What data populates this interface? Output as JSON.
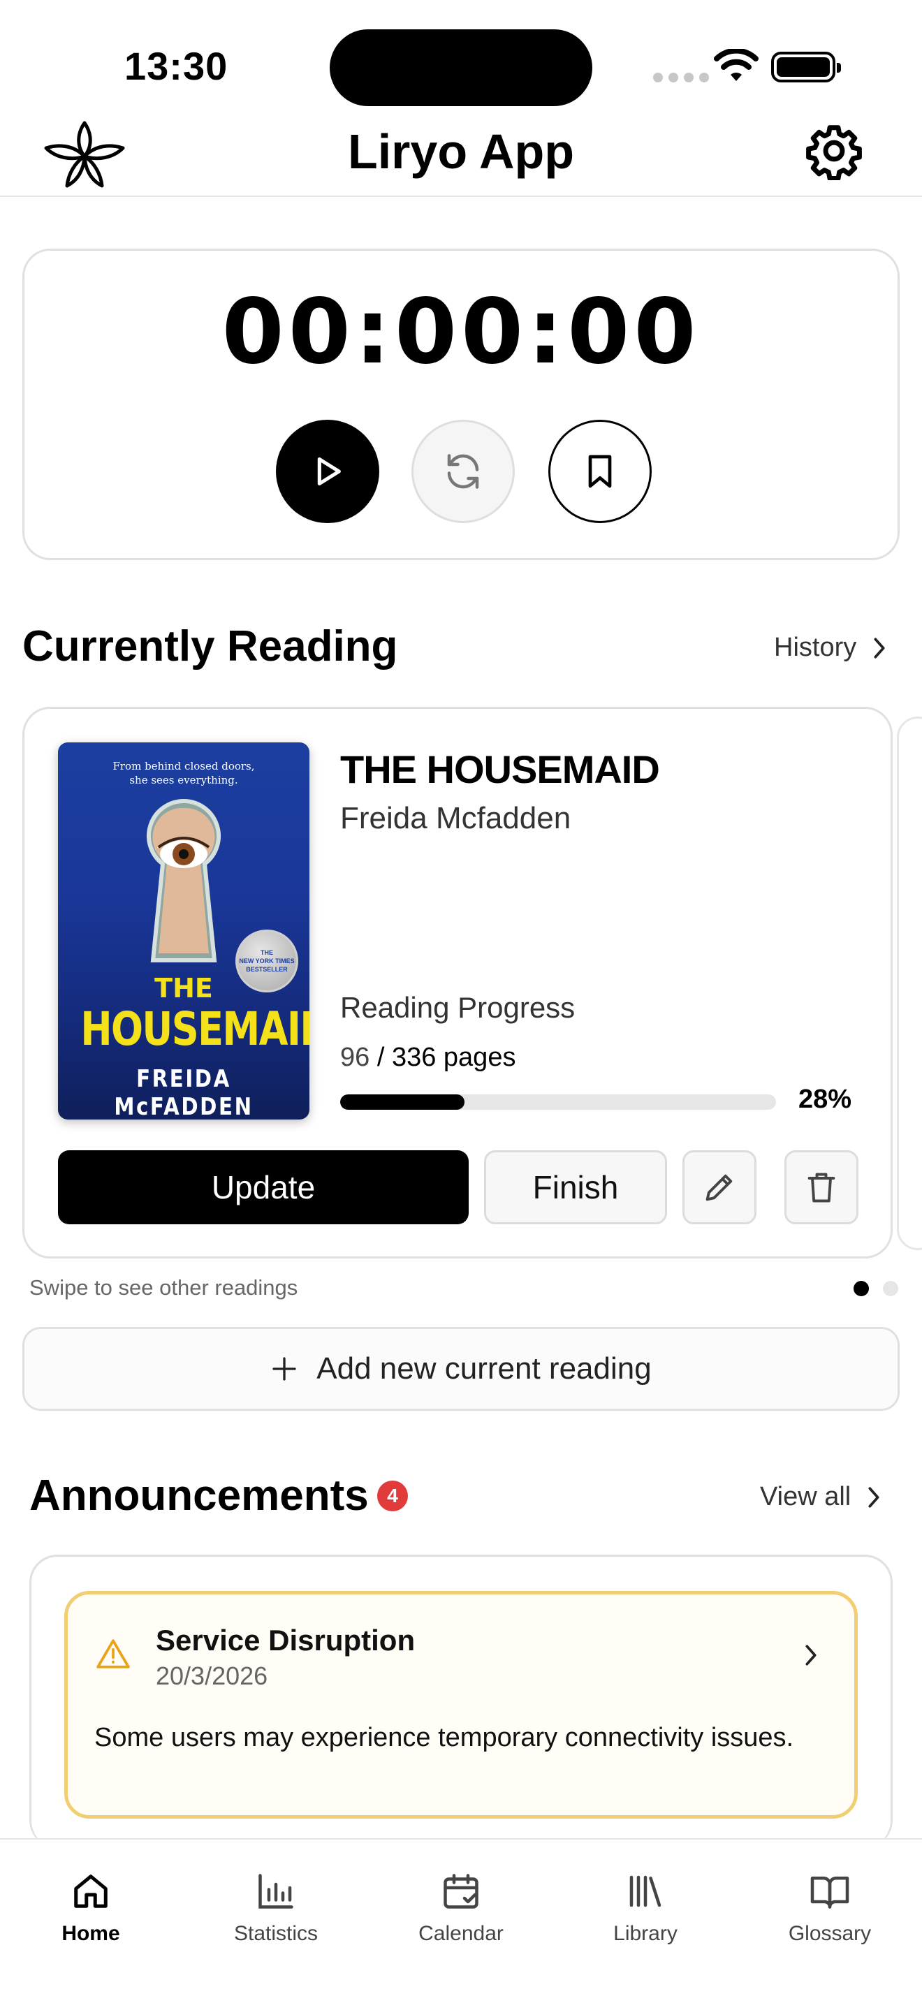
{
  "status_bar": {
    "time": "13:30"
  },
  "header": {
    "title": "Liryo App"
  },
  "timer": {
    "display": "00:00:00"
  },
  "currently_reading": {
    "section_title": "Currently Reading",
    "history_label": "History",
    "book": {
      "title": "THE HOUSEMAID",
      "author": "Freida Mcfadden",
      "cover": {
        "tagline_line1": "From behind closed doors,",
        "tagline_line2": "she sees everything.",
        "the": "THE",
        "title": "HOUSEMAID",
        "author": "FREIDA McFADDEN",
        "badge_line1": "THE",
        "badge_line2": "NEW YORK TIMES",
        "badge_line3": "BESTSELLER"
      },
      "progress_label": "Reading Progress",
      "current_page": "96",
      "pages_suffix": " / 336 pages",
      "progress_percent": "28%",
      "progress_value": 0.286
    },
    "update_label": "Update",
    "finish_label": "Finish",
    "swipe_hint": "Swipe to see other readings",
    "add_label": "Add new current reading"
  },
  "announcements": {
    "section_title": "Announcements",
    "count": "4",
    "view_all_label": "View all",
    "items": [
      {
        "title": "Service Disruption",
        "date": "20/3/2026",
        "body": "Some users may experience temporary connectivity issues."
      }
    ]
  },
  "tabs": [
    {
      "label": "Home",
      "icon": "home-icon",
      "active": true
    },
    {
      "label": "Statistics",
      "icon": "bar-chart-icon",
      "active": false
    },
    {
      "label": "Calendar",
      "icon": "calendar-icon",
      "active": false
    },
    {
      "label": "Library",
      "icon": "library-icon",
      "active": false
    },
    {
      "label": "Glossary",
      "icon": "book-open-icon",
      "active": false
    }
  ],
  "colors": {
    "accent": "#000000",
    "badge": "#e23b3b",
    "warning_border": "#f2ce73",
    "warning_icon": "#e8a317"
  }
}
